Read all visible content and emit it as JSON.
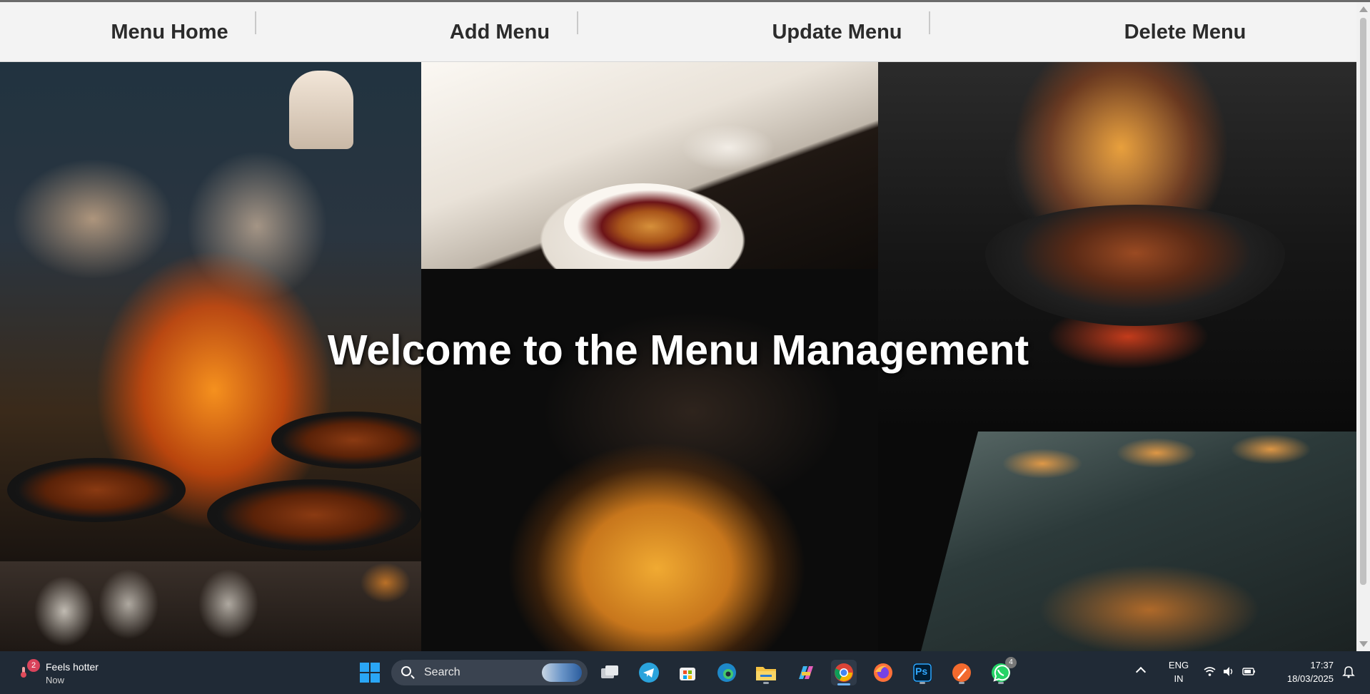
{
  "nav": {
    "items": [
      {
        "label": "Menu Home"
      },
      {
        "label": "Add Menu"
      },
      {
        "label": "Update Menu"
      },
      {
        "label": "Delete Menu"
      }
    ]
  },
  "hero": {
    "title": "Welcome to the Menu Management"
  },
  "taskbar": {
    "weather": {
      "badge": "2",
      "line1": "Feels hotter",
      "line2": "Now"
    },
    "search_label": "Search",
    "apps": [
      {
        "name": "task-view-icon"
      },
      {
        "name": "telegram-icon"
      },
      {
        "name": "microsoft-store-icon"
      },
      {
        "name": "edge-icon"
      },
      {
        "name": "file-explorer-icon"
      },
      {
        "name": "copilot-icon"
      },
      {
        "name": "chrome-icon",
        "active": true
      },
      {
        "name": "firefox-icon"
      },
      {
        "name": "photoshop-icon",
        "label": "Ps"
      },
      {
        "name": "pen-app-icon"
      },
      {
        "name": "whatsapp-icon",
        "badge": "4"
      }
    ],
    "lang_line1": "ENG",
    "lang_line2": "IN",
    "time": "17:37",
    "date": "18/03/2025"
  },
  "colors": {
    "nav_bg": "#f3f3f3",
    "nav_text": "#2b2b2b",
    "taskbar_bg": "#202a36",
    "accent": "#2aa6f5"
  }
}
